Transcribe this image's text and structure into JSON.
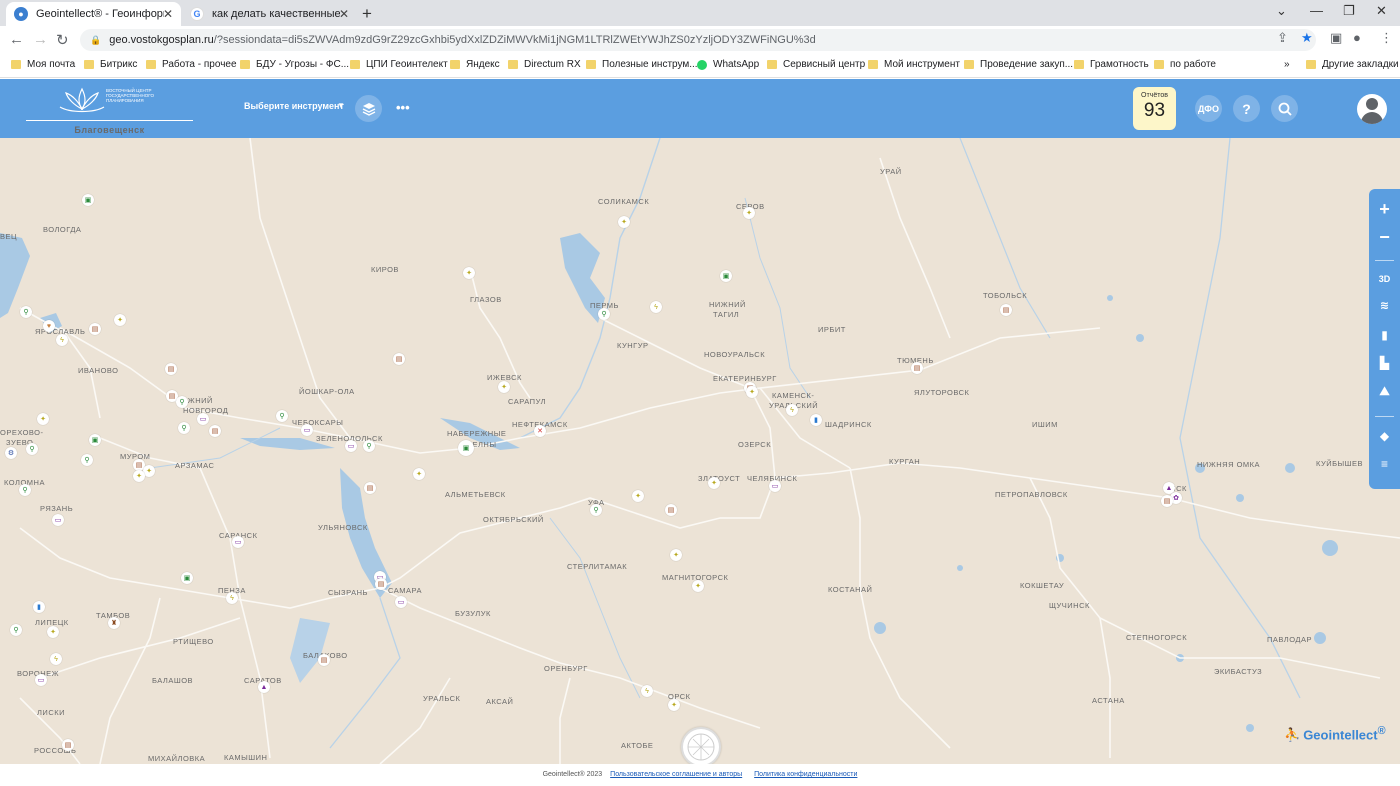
{
  "browser": {
    "tabs": [
      {
        "title": "Geointellect® - Геоинформаци",
        "active": true,
        "icon": "globe-icon"
      },
      {
        "title": "как делать качественные снимк",
        "active": false,
        "icon": "google-icon"
      }
    ],
    "new_tab": "+",
    "url": {
      "host": "geo.vostokgosplan.ru",
      "path": "/?sessiondata=di5sZWVAdm9zdG9rZ29zcGxhbi5ydXxlZDZiMWVkMi1jNGM1LTRlZWEtYWJhZS0zYzljODY3ZWFiNGU%3d"
    },
    "bookmarks": [
      {
        "label": "Моя почта",
        "icon": "folder-icon"
      },
      {
        "label": "Битрикс",
        "icon": "folder-icon"
      },
      {
        "label": "Работа - прочее",
        "icon": "folder-icon"
      },
      {
        "label": "БДУ - Угрозы - ФС...",
        "icon": "folder-icon"
      },
      {
        "label": "ЦПИ Геоинтелект",
        "icon": "folder-icon"
      },
      {
        "label": "Яндекс",
        "icon": "folder-icon"
      },
      {
        "label": "Directum RX",
        "icon": "folder-icon"
      },
      {
        "label": "Полезные инструм...",
        "icon": "folder-icon"
      },
      {
        "label": "WhatsApp",
        "icon": "whatsapp-icon"
      },
      {
        "label": "Сервисный центр",
        "icon": "folder-icon"
      },
      {
        "label": "Мой инструмент",
        "icon": "folder-icon"
      },
      {
        "label": "Проведение закуп...",
        "icon": "folder-icon"
      },
      {
        "label": "Грамотность",
        "icon": "folder-icon"
      },
      {
        "label": "по работе",
        "icon": "folder-icon"
      }
    ],
    "more_bookmarks": "»",
    "other_bookmarks": "Другие закладки"
  },
  "app": {
    "logo_org": "ВОСТОЧНЫЙ ЦЕНТР ГОСУДАРСТВЕННОГО ПЛАНИРОВАНИЯ",
    "city": "Благовещенск",
    "tool_select": "Выберите инструмент",
    "reports_label": "Отчётов",
    "reports_count": "93",
    "region_button": "ДФО",
    "help_button": "?",
    "accent_color": "#5b9ee0"
  },
  "map": {
    "cities": [
      {
        "name": "СОЛИКАМСК"
      },
      {
        "name": "СЕРОВ"
      },
      {
        "name": "УРАЙ"
      },
      {
        "name": "ВОЛОГДА"
      },
      {
        "name": "КИРОВ"
      },
      {
        "name": "ГЛАЗОВ"
      },
      {
        "name": "ПЕРМЬ"
      },
      {
        "name": "НИЖНИЙ"
      },
      {
        "name": "ТАГИЛ"
      },
      {
        "name": "ТОБОЛЬСК"
      },
      {
        "name": "ИРБИТ"
      },
      {
        "name": "КУНГУР"
      },
      {
        "name": "НОВОУРАЛЬСК"
      },
      {
        "name": "ТЮМЕНЬ"
      },
      {
        "name": "ЯЛУТОРОВСК"
      },
      {
        "name": "ИВАНОВО"
      },
      {
        "name": "ЙОШКАР-ОЛА"
      },
      {
        "name": "ИЖЕВСК"
      },
      {
        "name": "ЕКАТЕРИНБУРГ"
      },
      {
        "name": "КАМЕНСК-"
      },
      {
        "name": "УРАЛЬСКИЙ"
      },
      {
        "name": "САРАПУЛ"
      },
      {
        "name": "НИЖНИЙ"
      },
      {
        "name": "НОВГОРОД"
      },
      {
        "name": "ЧЕБОКСАРЫ"
      },
      {
        "name": "ЗЕЛЕНОДОЛЬСК"
      },
      {
        "name": "НАБЕРЕЖНЫЕ"
      },
      {
        "name": "ЧЕЛНЫ"
      },
      {
        "name": "НЕФТЕКАМСК"
      },
      {
        "name": "ШАДРИНСК"
      },
      {
        "name": "ИШИМ"
      },
      {
        "name": "ОРЕХОВО-"
      },
      {
        "name": "ЗУЕВО"
      },
      {
        "name": "МУРОМ"
      },
      {
        "name": "АРЗАМАС"
      },
      {
        "name": "ОЗЕРСК"
      },
      {
        "name": "КУРГАН"
      },
      {
        "name": "НИЖНЯЯ ОМКА"
      },
      {
        "name": "КУЙБЫШЕВ"
      },
      {
        "name": "КОЛОМНА"
      },
      {
        "name": "ЗЛАТОУСТ"
      },
      {
        "name": "ЧЕЛЯБИНСК"
      },
      {
        "name": "АЛЬМЕТЬЕВСК"
      },
      {
        "name": "ПЕТРОПАВЛОВСК"
      },
      {
        "name": "ОМСК"
      },
      {
        "name": "РЯЗАНЬ"
      },
      {
        "name": "УЛЬЯНОВСК"
      },
      {
        "name": "ОКТЯБРЬСКИЙ"
      },
      {
        "name": "УФА"
      },
      {
        "name": "САРАНСК"
      },
      {
        "name": "СТЕРЛИТАМАК"
      },
      {
        "name": "МАГНИТОГОРСК"
      },
      {
        "name": "ПЕНЗА"
      },
      {
        "name": "СЫЗРАНЬ"
      },
      {
        "name": "САМАРА"
      },
      {
        "name": "КОСТАНАЙ"
      },
      {
        "name": "КОКШЕТАУ"
      },
      {
        "name": "ЛИПЕЦК"
      },
      {
        "name": "ТАМБОВ"
      },
      {
        "name": "БУЗУЛУК"
      },
      {
        "name": "ЩУЧИНСК"
      },
      {
        "name": "РТИЩЕВО"
      },
      {
        "name": "СТЕПНОГОРСК"
      },
      {
        "name": "ПАВЛОДАР"
      },
      {
        "name": "ВОРОНЕЖ"
      },
      {
        "name": "БАЛАКОВО"
      },
      {
        "name": "ОРЕНБУРГ"
      },
      {
        "name": "ЭКИБАСТУЗ"
      },
      {
        "name": "БАЛАШОВ"
      },
      {
        "name": "САРАТОВ"
      },
      {
        "name": "УРАЛЬСК"
      },
      {
        "name": "АКСАЙ"
      },
      {
        "name": "ОРСК"
      },
      {
        "name": "АСТАНА"
      },
      {
        "name": "ЛИСКИ"
      },
      {
        "name": "РОССОШЬ"
      },
      {
        "name": "МИХАЙЛОВКА"
      },
      {
        "name": "КАМЫШИН"
      },
      {
        "name": "АКТОБЕ"
      },
      {
        "name": "ВЕЦ"
      },
      {
        "name": "ЯРОСЛАВЛЬ"
      }
    ]
  },
  "right_toolbar": {
    "zoom_in": "+",
    "zoom_out": "−",
    "mode_3d": "3D"
  },
  "brand": {
    "name": "Geointellect",
    "reg": "®"
  },
  "footer": {
    "copyright": "Geointellect® 2023",
    "agreement": "Пользовательское соглашение и авторы",
    "privacy": "Политика конфиденциальности"
  }
}
